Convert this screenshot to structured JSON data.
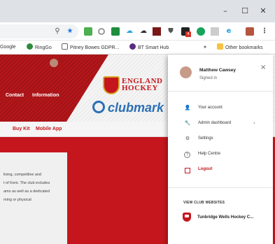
{
  "window": {
    "minimize": "–",
    "maximize": "☐",
    "close": "✕"
  },
  "toolbar": {
    "icons": [
      "search-icon",
      "star-icon",
      "extension-green-icon",
      "extension-circle-icon",
      "extension-green2-icon",
      "extension-cloud-icon",
      "extension-cloud2-icon",
      "extension-dark-icon",
      "shield-icon",
      "extension-badge-icon",
      "extension-teal-icon",
      "extension-grey-icon",
      "ie-icon",
      "profile-icon",
      "menu-icon"
    ],
    "badge_count": "4",
    "menu": "⋮"
  },
  "bookmarks": {
    "items": [
      {
        "label": "Google",
        "color": "#ffffff"
      },
      {
        "label": "RingGo",
        "color": "#2e8b3d"
      },
      {
        "label": "Pitney Bowes GDPR...",
        "color": "#ffffff"
      },
      {
        "label": "BT Smart Hub",
        "color": "#5b2c83"
      }
    ],
    "overflow": "»",
    "other": "Other bookmarks"
  },
  "site": {
    "nav": [
      "Contact",
      "Information"
    ],
    "subnav": [
      "Buy Kit",
      "Mobile App"
    ],
    "logo_text": "ENGLAND HOCKEY",
    "logo_line1": "ENGLAND",
    "logo_line2": "HOCKEY",
    "clubmark": "clubmark",
    "card_lines": [
      "living, competitive and",
      "t of Kent. The club includes",
      "ams as well as a dedicated",
      "ming or physical"
    ],
    "brand_red": "#c5161d"
  },
  "profile_panel": {
    "name": "Matthew Cawsey",
    "status": "Signed in",
    "close": "×",
    "items": [
      {
        "label": "Your account",
        "icon": "person-icon",
        "glyph": "👤",
        "color": "#333"
      },
      {
        "label": "Admin dashboard",
        "icon": "wrench-icon",
        "glyph": "🔧",
        "color": "#333",
        "arrow": "›"
      },
      {
        "label": "Settings",
        "icon": "gear-icon",
        "glyph": "⚙",
        "color": "#333"
      },
      {
        "label": "Help Centre",
        "icon": "help-icon",
        "glyph": "?",
        "color": "#333"
      },
      {
        "label": "Logout",
        "icon": "logout-icon",
        "glyph": "⏏",
        "color": "#c5161d"
      }
    ],
    "club_section_title": "VIEW CLUB WEBSITES",
    "clubs": [
      {
        "label": "Tunbridge Wells Hockey C..."
      }
    ]
  }
}
